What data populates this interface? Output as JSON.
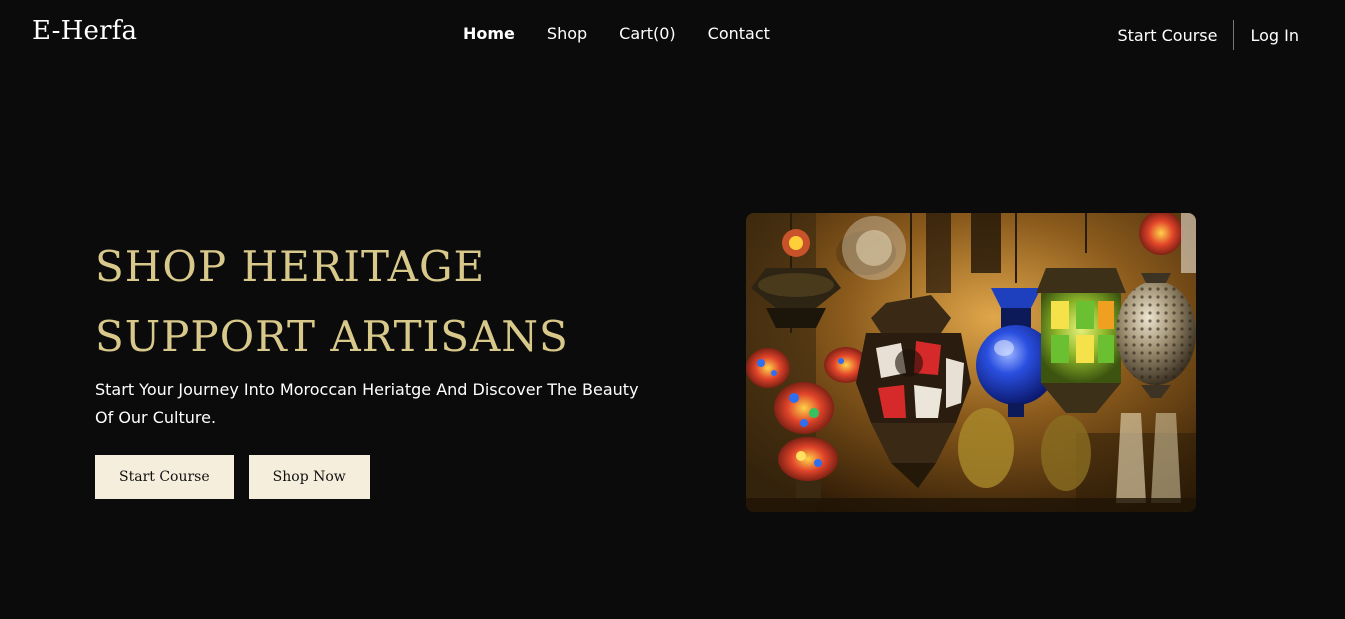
{
  "brand": {
    "logo": "E-Herfa"
  },
  "nav": {
    "links": [
      {
        "label": "Home"
      },
      {
        "label": "Shop"
      },
      {
        "label": "Cart(0)"
      },
      {
        "label": "Contact"
      }
    ],
    "start_course": "Start Course",
    "login": "Log In"
  },
  "hero": {
    "title_line1": "SHOP HERITAGE",
    "title_line2": "SUPPORT ARTISANS",
    "subtitle": "Start Your Journey Into Moroccan Heriatge And Discover The Beauty Of Our Culture.",
    "buttons": {
      "start_course": "Start Course",
      "shop_now": "Shop Now"
    },
    "image": {
      "subject": "moroccan-lanterns-photo"
    }
  },
  "colors": {
    "background": "#0b0b0c",
    "title_gold": "#d8c88a",
    "button_cream": "#f5eedc",
    "text": "#ffffff"
  }
}
